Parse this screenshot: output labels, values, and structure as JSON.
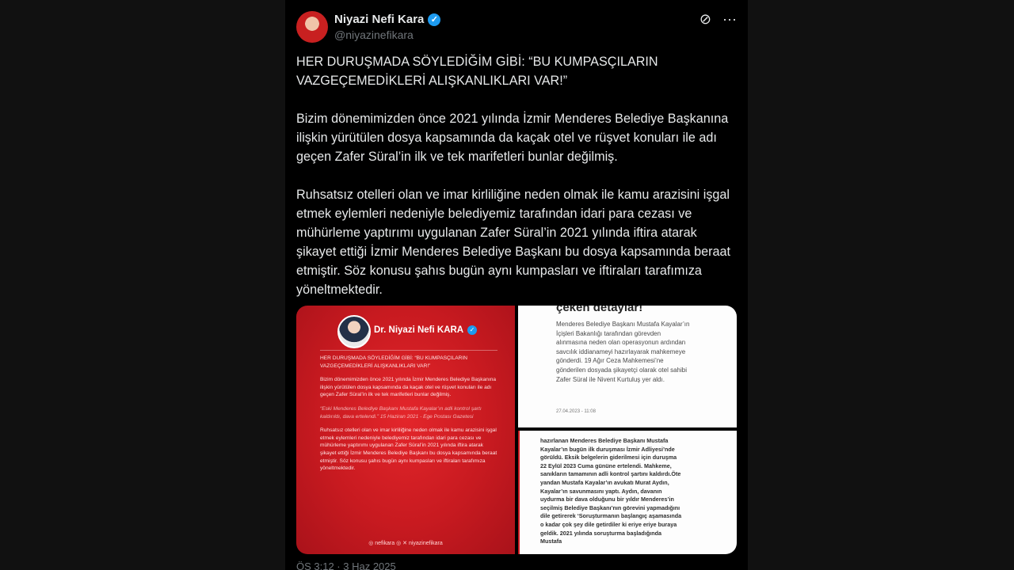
{
  "author": {
    "display_name": "Niyazi Nefi Kara",
    "handle": "@niyazinefikara",
    "verified_mark": "✓",
    "avatar_icon": "avatar-photo"
  },
  "actions": {
    "grok_icon": "⊘",
    "more_icon": "···"
  },
  "tweet": {
    "paragraphs": [
      "HER DURUŞMADA SÖYLEDİĞİM GİBİ: “BU KUMPASÇILARIN VAZGEÇEMEDİKLERİ ALIŞKANLIKLARI VAR!”",
      "Bizim dönemimizden önce 2021 yılında İzmir Menderes Belediye Başkanına ilişkin yürütülen dosya kapsamında da kaçak otel ve rüşvet konuları ile adı geçen Zafer Süral’in ilk ve tek marifetleri bunlar değilmiş.",
      "Ruhsatsız otelleri olan ve imar kirliliğine neden olmak ile kamu arazisini işgal etmek eylemleri nedeniyle belediyemiz tarafından idari para cezası ve mühürleme yaptırımı uygulanan Zafer Süral’in 2021 yılında iftira atarak şikayet ettiği İzmir Menderes Belediye Başkanı bu dosya kapsamında beraat etmiştir. Söz konusu şahıs bugün aynı kumpasları ve iftiraları tarafımıza yöneltmektedir."
    ],
    "timestamp": "ÖS 3:12 · 3 Haz 2025"
  },
  "media": {
    "red_card": {
      "name": "Dr. Niyazi Nefi KARA",
      "check": "✓",
      "paragraphs": [
        "HER DURUŞMADA SÖYLEDİĞİM GİBİ: “BU KUMPASÇILARIN VAZGEÇEMEDİKLERİ ALIŞKANLIKLARI VAR!”",
        "Bizim dönemimizden önce 2021 yılında İzmir Menderes Belediye Başkanına ilişkin yürütülen dosya kapsamında da kaçak otel ve rüşvet konuları ile adı geçen Zafer Süral’in ilk ve tek marifetleri bunlar değilmiş.",
        "“Eski Menderes Belediye Başkanı Mustafa Kayalar’ın adli kontrol şartı kaldırıldı, dava ertelendi.” 15 Haziran 2021 - Ege Postası Gazetesi",
        "Ruhsatsız otelleri olan ve imar kirliliğine neden olmak ile kamu arazisini işgal etmek eylemleri nedeniyle belediyemiz tarafından idari para cezası ve mühürleme yaptırımı uygulanan Zafer Süral’in 2021 yılında iftira atarak şikayet ettiği İzmir Menderes Belediye Başkanı bu dosya kapsamında beraat etmiştir. Söz konusu şahıs bugün aynı kumpasları ve iftiraları tarafımıza yöneltmektedir."
      ],
      "footer": "◎ nefikara   ◎ ✕ niyazinefikara"
    },
    "article_top": {
      "heading": "çeken detaylar!",
      "body": "Menderes Belediye Başkanı Mustafa Kayalar’ın İçişleri Bakanlığı tarafından görevden alınmasına neden olan operasyonun ardından savcılık iddianameyi hazırlayarak mahkemeye gönderdi. 19 Ağır Ceza Mahkemesi’ne gönderilen dosyada şikayetçi olarak otel sahibi Zafer Süral ile Nivent Kurtuluş yer aldı.",
      "date": "27.04.2023 - 11:08"
    },
    "article_bottom": {
      "body": "hazırlanan Menderes Belediye Başkanı Mustafa Kayalar’ın bugün ilk duruşması İzmir Adliyesi’nde görüldü. Eksik belgelerin giderilmesi için duruşma 22 Eylül 2023 Cuma gününe ertelendi. Mahkeme, sanıkların tamamının adli kontrol şartını kaldırdı.Öte yandan Mustafa Kayalar’ın avukatı Murat Aydın, Kayalar’ın savunmasını yaptı. Aydın, davanın uydurma bir dava olduğunu bir yıldır Menderes’in seçilmiş Belediye Başkanı’nın görevini yapmadığını dile getirerek ‘Soruşturmanın başlangıç aşamasında o kadar çok şey dile getirdiler ki eriye eriye buraya geldik. 2021 yılında soruşturma başladığında Mustafa"
    }
  },
  "colors": {
    "page_bg": "#1a1a1a",
    "tweet_bg": "#000000",
    "text_primary": "#e7e9ea",
    "text_secondary": "#71767b",
    "verified_blue": "#1d9bf0",
    "card_red": "#c81a20"
  }
}
